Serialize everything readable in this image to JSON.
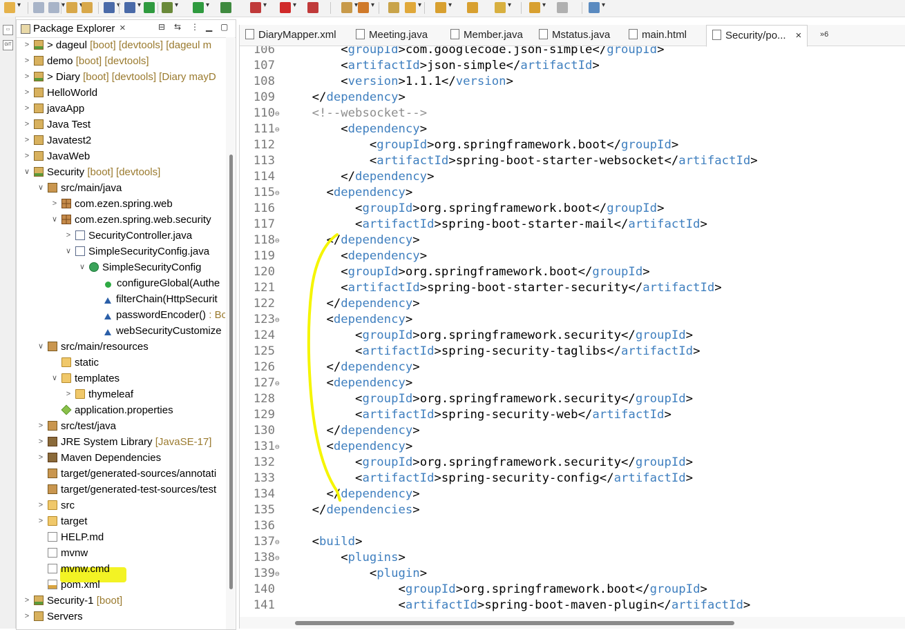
{
  "toolbar": {
    "icons": [
      "new-icon",
      "save-icon",
      "save-all-icon",
      "open-type-icon",
      "open-task-icon",
      "console-icon",
      "skip-breakpoints-icon",
      "spring-boot-dashboard-icon",
      "debug-icon",
      "run-icon",
      "coverage-icon",
      "external-tools-icon",
      "stop-icon",
      "terminate-icon",
      "new-package-icon",
      "new-class-icon",
      "open-perspective-icon",
      "search-icon",
      "next-annotation-icon",
      "previous-annotation-icon",
      "last-edit-icon",
      "back-icon",
      "forward-icon",
      "pin-editor-icon"
    ]
  },
  "explorer": {
    "title": "Package Explorer",
    "close_glyph": "×",
    "items": [
      {
        "label": "> dageul",
        "deco": "[boot] [devtools] [dageul m",
        "twisty": ">"
      },
      {
        "label": "demo",
        "deco": "[boot] [devtools]",
        "twisty": ">"
      },
      {
        "label": "> Diary",
        "deco": "[boot] [devtools] [Diary mayD",
        "twisty": ">"
      },
      {
        "label": "HelloWorld",
        "deco": "",
        "twisty": ">"
      },
      {
        "label": "javaApp",
        "deco": "",
        "twisty": ">"
      },
      {
        "label": "Java Test",
        "deco": "",
        "twisty": ">"
      },
      {
        "label": "Javatest2",
        "deco": "",
        "twisty": ">"
      },
      {
        "label": "JavaWeb",
        "deco": "",
        "twisty": ">"
      },
      {
        "label": "Security",
        "deco": "[boot] [devtools]",
        "twisty": "∨"
      },
      {
        "label": "src/main/java",
        "deco": "",
        "twisty": "∨"
      },
      {
        "label": "com.ezen.spring.web",
        "deco": "",
        "twisty": ">"
      },
      {
        "label": "com.ezen.spring.web.security",
        "deco": "",
        "twisty": "∨"
      },
      {
        "label": "SecurityController.java",
        "deco": "",
        "twisty": ">"
      },
      {
        "label": "SimpleSecurityConfig.java",
        "deco": "",
        "twisty": "∨"
      },
      {
        "label": "SimpleSecurityConfig",
        "deco": "",
        "twisty": "∨"
      },
      {
        "label": "configureGlobal(Authe",
        "deco": "",
        "twisty": ""
      },
      {
        "label": "filterChain(HttpSecurit",
        "deco": "",
        "twisty": ""
      },
      {
        "label": "passwordEncoder()",
        "deco": ": Bc",
        "twisty": ""
      },
      {
        "label": "webSecurityCustomize",
        "deco": "",
        "twisty": ""
      },
      {
        "label": "src/main/resources",
        "deco": "",
        "twisty": "∨"
      },
      {
        "label": "static",
        "deco": "",
        "twisty": ""
      },
      {
        "label": "templates",
        "deco": "",
        "twisty": "∨"
      },
      {
        "label": "thymeleaf",
        "deco": "",
        "twisty": ">"
      },
      {
        "label": "application.properties",
        "deco": "",
        "twisty": ""
      },
      {
        "label": "src/test/java",
        "deco": "",
        "twisty": ">"
      },
      {
        "label": "JRE System Library",
        "deco": "[JavaSE-17]",
        "twisty": ">"
      },
      {
        "label": "Maven Dependencies",
        "deco": "",
        "twisty": ">"
      },
      {
        "label": "target/generated-sources/annotati",
        "deco": "",
        "twisty": ""
      },
      {
        "label": "target/generated-test-sources/test",
        "deco": "",
        "twisty": ""
      },
      {
        "label": "src",
        "deco": "",
        "twisty": ">"
      },
      {
        "label": "target",
        "deco": "",
        "twisty": ">"
      },
      {
        "label": "HELP.md",
        "deco": "",
        "twisty": ""
      },
      {
        "label": "mvnw",
        "deco": "",
        "twisty": ""
      },
      {
        "label": "mvnw.cmd",
        "deco": "",
        "twisty": ""
      },
      {
        "label": "pom.xml",
        "deco": "",
        "twisty": ""
      },
      {
        "label": "Security-1",
        "deco": "[boot]",
        "twisty": ">"
      },
      {
        "label": "Servers",
        "deco": "",
        "twisty": ">"
      }
    ]
  },
  "editor": {
    "tabs": [
      {
        "label": "DiaryMapper.xml"
      },
      {
        "label": "Meeting.java"
      },
      {
        "label": "Member.java"
      },
      {
        "label": "Mstatus.java"
      },
      {
        "label": "main.html"
      },
      {
        "label": "Security/po...",
        "active": true
      }
    ],
    "overflow": "»6",
    "lines": [
      {
        "n": "106",
        "indent": "        ",
        "kind": "el",
        "tag": "groupId",
        "text": "com.googlecode.json-simple"
      },
      {
        "n": "107",
        "indent": "        ",
        "kind": "el",
        "tag": "artifactId",
        "text": "json-simple"
      },
      {
        "n": "108",
        "indent": "        ",
        "kind": "el",
        "tag": "version",
        "text": "1.1.1"
      },
      {
        "n": "109",
        "indent": "    ",
        "kind": "close",
        "tag": "dependency"
      },
      {
        "n": "110",
        "indent": "    ",
        "kind": "comment",
        "text": "<!--websocket-->",
        "fold": true
      },
      {
        "n": "111",
        "indent": "        ",
        "kind": "open",
        "tag": "dependency",
        "fold": true
      },
      {
        "n": "112",
        "indent": "            ",
        "kind": "el",
        "tag": "groupId",
        "text": "org.springframework.boot"
      },
      {
        "n": "113",
        "indent": "            ",
        "kind": "el",
        "tag": "artifactId",
        "text": "spring-boot-starter-websocket"
      },
      {
        "n": "114",
        "indent": "        ",
        "kind": "close",
        "tag": "dependency"
      },
      {
        "n": "115",
        "indent": "      ",
        "kind": "open",
        "tag": "dependency",
        "fold": true
      },
      {
        "n": "116",
        "indent": "          ",
        "kind": "el",
        "tag": "groupId",
        "text": "org.springframework.boot"
      },
      {
        "n": "117",
        "indent": "          ",
        "kind": "el",
        "tag": "artifactId",
        "text": "spring-boot-starter-mail"
      },
      {
        "n": "118",
        "indent": "      ",
        "kind": "close",
        "tag": "dependency",
        "fold": true
      },
      {
        "n": "119",
        "indent": "        ",
        "kind": "open",
        "tag": "dependency"
      },
      {
        "n": "120",
        "indent": "        ",
        "kind": "el",
        "tag": "groupId",
        "text": "org.springframework.boot"
      },
      {
        "n": "121",
        "indent": "        ",
        "kind": "el",
        "tag": "artifactId",
        "text": "spring-boot-starter-security"
      },
      {
        "n": "122",
        "indent": "      ",
        "kind": "close",
        "tag": "dependency"
      },
      {
        "n": "123",
        "indent": "      ",
        "kind": "open",
        "tag": "dependency",
        "fold": true
      },
      {
        "n": "124",
        "indent": "          ",
        "kind": "el",
        "tag": "groupId",
        "text": "org.springframework.security"
      },
      {
        "n": "125",
        "indent": "          ",
        "kind": "el",
        "tag": "artifactId",
        "text": "spring-security-taglibs"
      },
      {
        "n": "126",
        "indent": "      ",
        "kind": "close",
        "tag": "dependency"
      },
      {
        "n": "127",
        "indent": "      ",
        "kind": "open",
        "tag": "dependency",
        "fold": true
      },
      {
        "n": "128",
        "indent": "          ",
        "kind": "el",
        "tag": "groupId",
        "text": "org.springframework.security"
      },
      {
        "n": "129",
        "indent": "          ",
        "kind": "el",
        "tag": "artifactId",
        "text": "spring-security-web"
      },
      {
        "n": "130",
        "indent": "      ",
        "kind": "close",
        "tag": "dependency"
      },
      {
        "n": "131",
        "indent": "      ",
        "kind": "open",
        "tag": "dependency",
        "fold": true
      },
      {
        "n": "132",
        "indent": "          ",
        "kind": "el",
        "tag": "groupId",
        "text": "org.springframework.security"
      },
      {
        "n": "133",
        "indent": "          ",
        "kind": "el",
        "tag": "artifactId",
        "text": "spring-security-config"
      },
      {
        "n": "134",
        "indent": "      ",
        "kind": "close",
        "tag": "dependency"
      },
      {
        "n": "135",
        "indent": "    ",
        "kind": "close",
        "tag": "dependencies"
      },
      {
        "n": "136",
        "indent": "",
        "kind": "blank"
      },
      {
        "n": "137",
        "indent": "    ",
        "kind": "open",
        "tag": "build",
        "fold": true
      },
      {
        "n": "138",
        "indent": "        ",
        "kind": "open",
        "tag": "plugins",
        "fold": true
      },
      {
        "n": "139",
        "indent": "            ",
        "kind": "open",
        "tag": "plugin",
        "fold": true
      },
      {
        "n": "140",
        "indent": "                ",
        "kind": "el",
        "tag": "groupId",
        "text": "org.springframework.boot"
      },
      {
        "n": "141",
        "indent": "                ",
        "kind": "el",
        "tag": "artifactId",
        "text": "spring-boot-maven-plugin"
      }
    ]
  },
  "colors": {
    "tag": "#3f7fbf",
    "comment": "#8e8e8e",
    "highlight": "#f2f218",
    "annotation_stroke": "#f5f500"
  }
}
